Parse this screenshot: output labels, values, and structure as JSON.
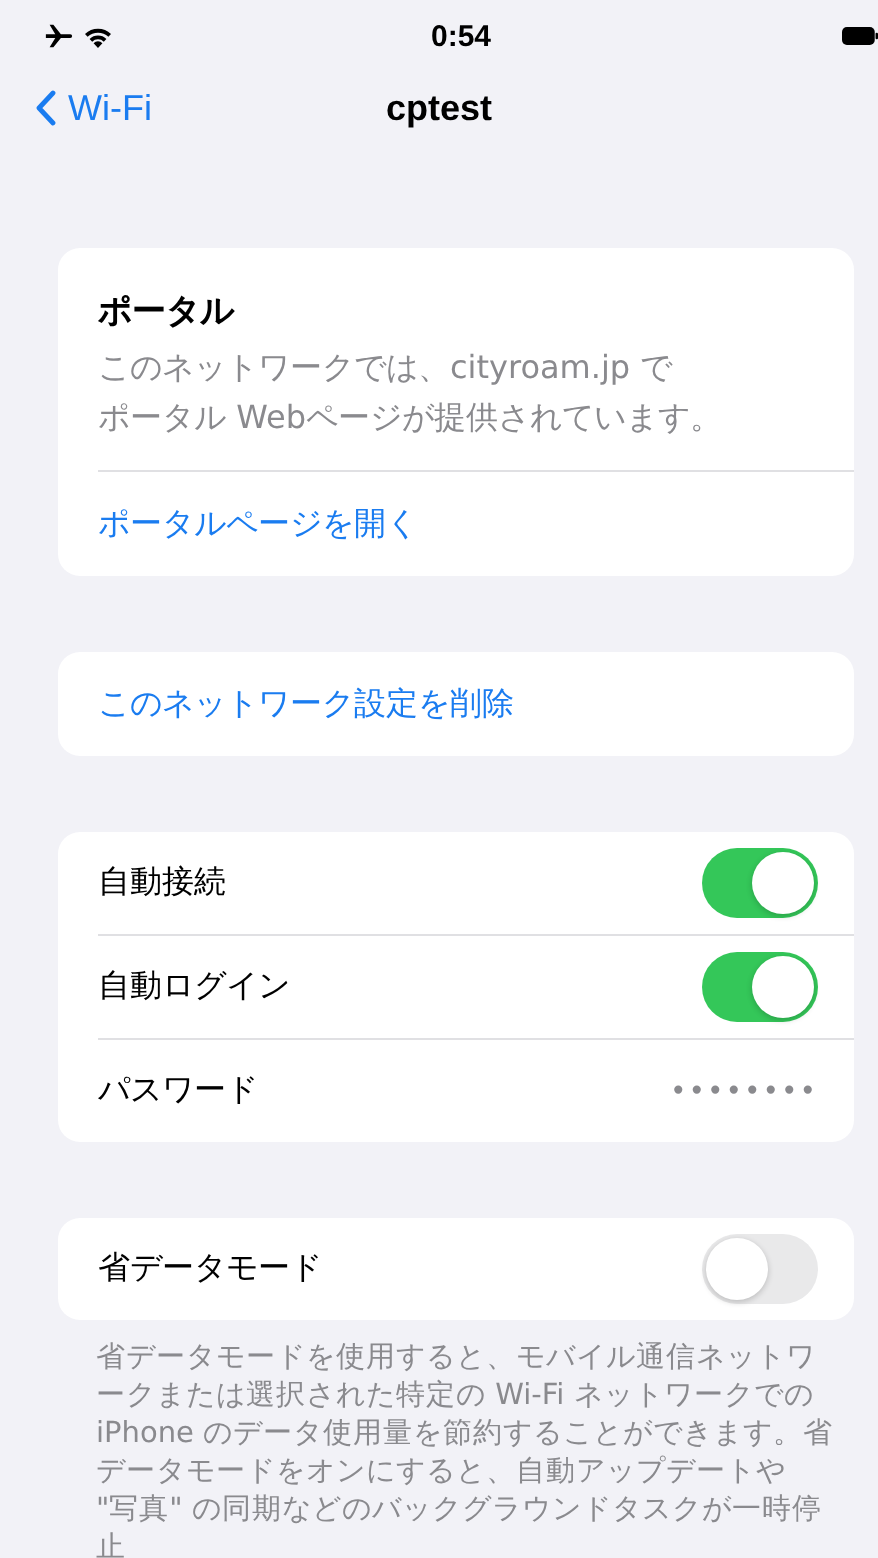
{
  "status_bar": {
    "time": "0:54"
  },
  "nav": {
    "back": "Wi-Fi",
    "title": "cptest"
  },
  "portal": {
    "title": "ポータル",
    "description_lines": [
      "このネットワークでは、cityroam.jp で",
      "ポータル Webページが提供されています。"
    ],
    "action": "ポータルページを開く"
  },
  "forget": {
    "action": "このネットワーク設定を削除"
  },
  "settings": [
    {
      "kind": "toggle",
      "label": "自動接続",
      "on": true
    },
    {
      "kind": "toggle",
      "label": "自動ログイン",
      "on": true
    },
    {
      "kind": "value",
      "label": "パスワード",
      "value": "••••••••"
    }
  ],
  "low_data": {
    "label": "省データモード",
    "on": false,
    "footer": "省データモードを使用すると、モバイル通信ネットワークまたは選択された特定の Wi-Fi ネットワークでの iPhone のデータ使用量を節約することができます。省データモードをオンにすると、自動アップデートや \"写真\" の同期などのバックグラウンドタスクが一時停止"
  }
}
